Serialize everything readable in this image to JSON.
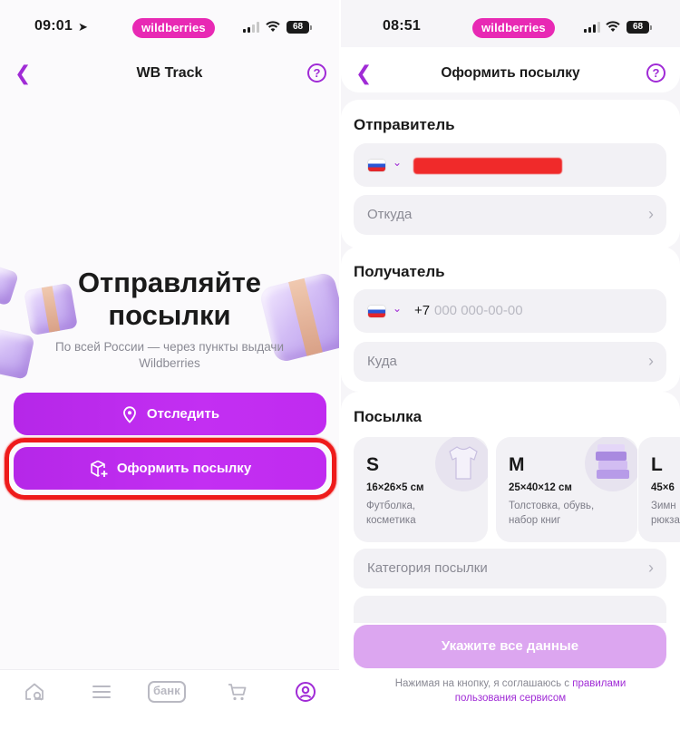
{
  "left": {
    "status": {
      "time": "09:01",
      "badge": "wildberries",
      "battery": "68"
    },
    "nav": {
      "title": "WB Track"
    },
    "hero": {
      "title_line1": "Отправляйте",
      "title_line2": "посылки",
      "subtitle": "По всей России — через пункты выдачи Wildberries"
    },
    "buttons": {
      "track": "Отследить",
      "create": "Оформить посылку"
    },
    "tabbar": {
      "bank_label": "банк"
    },
    "colors": {
      "accent": "#c02bf0",
      "highlight": "#ee1b1b"
    }
  },
  "right": {
    "status": {
      "time": "08:51",
      "badge": "wildberries",
      "battery": "68"
    },
    "nav": {
      "title": "Оформить посылку"
    },
    "sender": {
      "title": "Отправитель",
      "from_label": "Откуда"
    },
    "recipient": {
      "title": "Получатель",
      "phone_prefix": "+7",
      "phone_placeholder": "000 000-00-00",
      "to_label": "Куда"
    },
    "parcel": {
      "title": "Посылка",
      "sizes": [
        {
          "size": "S",
          "dims": "16×26×5 см",
          "desc": "Футболка, косметика",
          "icon": "tshirt-icon"
        },
        {
          "size": "M",
          "dims": "25×40×12 см",
          "desc": "Толстовка, обувь, набор книг",
          "icon": "books-icon"
        },
        {
          "size": "L",
          "dims": "45×6",
          "desc": "Зимн рюкза",
          "icon": "box-icon"
        }
      ],
      "category_label": "Категория посылки"
    },
    "submit_label": "Укажите все данные",
    "terms_text": "Нажимая на кнопку, я соглашаюсь с ",
    "terms_link": "правилами пользования сервисом"
  }
}
